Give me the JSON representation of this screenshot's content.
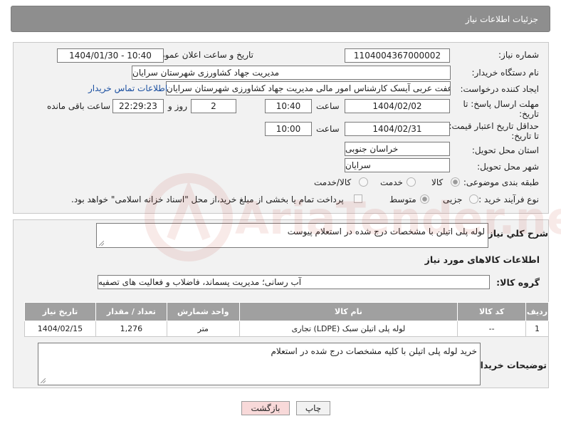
{
  "header": {
    "title": "جزئیات اطلاعات نیاز"
  },
  "labels": {
    "need_number": "شماره نیاز:",
    "announce_datetime": "تاریخ و ساعت اعلان عمومی:",
    "buyer_org": "نام دستگاه خریدار:",
    "creator": "ایجاد کننده درخواست:",
    "reply_deadline_1": "مهلت ارسال پاسخ: تا",
    "reply_deadline_2": "تاریخ:",
    "hour": "ساعت",
    "days_and": "روز و",
    "hours_left": "ساعت باقی مانده",
    "price_validity_1": "حداقل تاریخ اعتبار قیمت:",
    "price_validity_2": "تا تاریخ:",
    "delivery_province": "استان محل تحویل:",
    "delivery_city": "شهر محل تحویل:",
    "category": "طبقه بندی موضوعی:",
    "purchase_type": "نوع فرآیند خرید :",
    "overall_desc": "شرح کلي نياز:",
    "goods_info": "اطلاعات کالاهای مورد نیاز",
    "goods_group": "گروه کالا:",
    "buyer_notes": "توضیحات خریدار:"
  },
  "values": {
    "need_number": "1104004367000002",
    "announce_datetime": "1404/01/30 - 10:40",
    "buyer_org": "مدیریت جهاد کشاورزی شهرستان سرایان",
    "creator": "عفت عربی آیسک کارشناس امور مالی مدیریت جهاد کشاورزی شهرستان سرایان",
    "reply_date": "1404/02/02",
    "reply_time": "10:40",
    "reply_days": "2",
    "reply_remaining": "22:29:23",
    "price_date": "1404/02/31",
    "price_time": "10:00",
    "province": "خراسان جنوبی",
    "city": "سرایان",
    "overall_desc": "لوله پلی اتیلن با مشخصات درج شده در استعلام پیوست",
    "goods_group": "آب رسانی؛ مدیریت پسماند، فاضلاب و فعالیت های تصفیه",
    "buyer_notes": "خرید لوله پلی اتیلن با کلیه مشخصات درج شده در استعلام"
  },
  "links": {
    "buyer_contact": "اطلاعات تماس خریدار"
  },
  "category_options": {
    "goods": "کالا",
    "service": "خدمت",
    "goods_service": "کالا/خدمت",
    "selected": "goods"
  },
  "purchase_options": {
    "partial": "جزیی",
    "medium": "متوسط",
    "selected": "medium"
  },
  "payment_note": "پرداخت تمام یا بخشی از مبلغ خرید،از محل \"اسناد خزانه اسلامی\" خواهد بود.",
  "table": {
    "headers": [
      "ردیف",
      "کد کالا",
      "نام کالا",
      "واحد شمارش",
      "تعداد / مقدار",
      "تاریخ نیاز"
    ],
    "rows": [
      [
        "1",
        "--",
        "لوله پلی اتیلن سبک (LDPE) تجاری",
        "متر",
        "1,276",
        "1404/02/15"
      ]
    ]
  },
  "buttons": {
    "print": "چاپ",
    "back": "بازگشت"
  },
  "watermark": "AriaTender.neT",
  "colors": {
    "header_bg": "#8e8e8e",
    "link": "#1a4fa0",
    "back_button_bg": "#f8d9d9",
    "table_header_bg": "#a0a0a0"
  }
}
